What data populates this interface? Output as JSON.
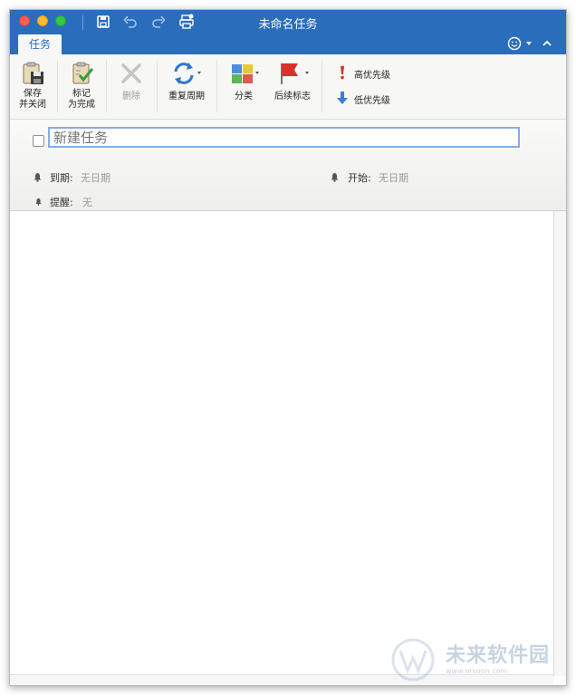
{
  "window": {
    "title": "未命名任务"
  },
  "ribbon_tab": {
    "label": "任务"
  },
  "ribbon": {
    "save_close": {
      "line1": "保存",
      "line2": "并关闭"
    },
    "mark_complete": {
      "line1": "标记",
      "line2": "为完成"
    },
    "delete": {
      "label": "删除"
    },
    "recurrence": {
      "label": "重复周期"
    },
    "categorize": {
      "label": "分类"
    },
    "follow_up": {
      "label": "后续标志"
    },
    "high_priority": {
      "label": "高优先级"
    },
    "low_priority": {
      "label": "低优先级"
    }
  },
  "form": {
    "subject_placeholder": "新建任务",
    "due": {
      "label": "到期:",
      "value": "无日期"
    },
    "start": {
      "label": "开始:",
      "value": "无日期"
    },
    "reminder": {
      "label": "提醒:",
      "value": "无"
    }
  },
  "watermark": {
    "text": "未来软件园",
    "url": "www.orsoon.com"
  },
  "colors": {
    "accent": "#2a6dbb",
    "flag": "#d9322b",
    "priority_high": "#d9322b",
    "priority_low": "#3b7fd4",
    "focus": "#82aee3"
  }
}
